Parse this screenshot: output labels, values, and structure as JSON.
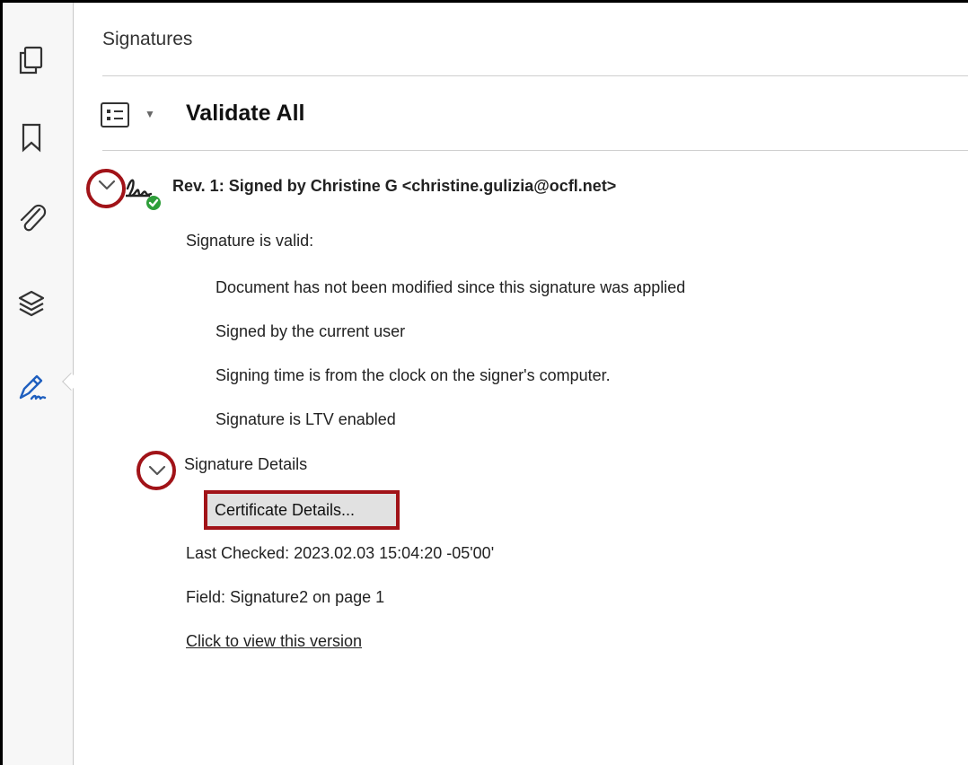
{
  "rail": {
    "icons": [
      "pages-icon",
      "bookmark-icon",
      "attachment-icon",
      "layers-icon",
      "signature-pen-icon"
    ]
  },
  "panel": {
    "title": "Signatures",
    "validate_all": "Validate All"
  },
  "revision": {
    "title": "Rev. 1: Signed by Christine G <christine.gulizia@ocfl.net>",
    "status": "Signature is valid:",
    "details": [
      "Document has not been modified since this signature was applied",
      "Signed by the current user",
      "Signing time is from the clock on the signer's computer.",
      "Signature is LTV enabled"
    ],
    "signature_details_label": "Signature Details",
    "certificate_button": "Certificate Details...",
    "last_checked": "Last Checked: 2023.02.03 15:04:20 -05'00'",
    "field": "Field: Signature2 on page 1",
    "view_version_link": "Click to view this version"
  },
  "colors": {
    "highlight_red": "#a11318",
    "valid_green": "#2e9e3a",
    "accent_blue": "#1f5fbf"
  }
}
